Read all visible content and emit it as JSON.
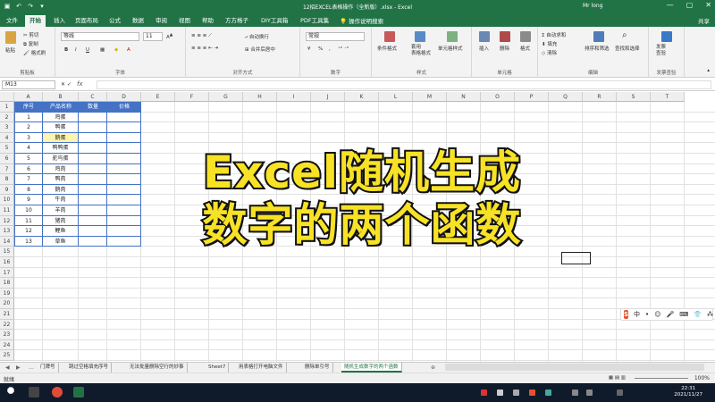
{
  "titlebar": {
    "title": "12招EXCEL表格操作（全新版）.xlsx - Excel",
    "user": "Mr long",
    "minimize": "—",
    "maximize": "▢",
    "close": "✕"
  },
  "tabs": [
    "文件",
    "开始",
    "插入",
    "页面布局",
    "公式",
    "数据",
    "审阅",
    "视图",
    "帮助",
    "方方格子",
    "DIY工具箱",
    "PDF工具集"
  ],
  "active_tab": "开始",
  "tell_me": "操作说明搜索",
  "share": "共享",
  "ribbon": {
    "clipboard": {
      "paste": "粘贴",
      "cut": "剪切",
      "copy": "复制",
      "format_painter": "格式刷",
      "label": "剪贴板"
    },
    "font": {
      "name": "等线",
      "size": "11",
      "bold": "B",
      "italic": "I",
      "underline": "U",
      "label": "字体"
    },
    "align": {
      "wrap": "自动换行",
      "merge": "合并后居中",
      "label": "对齐方式"
    },
    "number": {
      "format": "常规",
      "percent": "%",
      "comma": ",",
      "label": "数字"
    },
    "styles": {
      "cond": "条件格式",
      "table": "套用\n表格格式",
      "cell": "单元格样式",
      "label": "样式"
    },
    "cells": {
      "insert": "插入",
      "delete": "删除",
      "format": "格式",
      "label": "单元格"
    },
    "editing": {
      "autosum": "自动求和",
      "fill": "填充",
      "clear": "清除",
      "sort": "排序和筛选",
      "find": "查找和选择",
      "label": "编辑"
    },
    "send": {
      "label": "发票\n查验",
      "group": "发票查验"
    }
  },
  "formula_bar": {
    "name_box": "M13",
    "fx": "fx",
    "value": ""
  },
  "columns": [
    "A",
    "B",
    "C",
    "D",
    "E",
    "F",
    "G",
    "H",
    "I",
    "J",
    "K",
    "L",
    "M",
    "N",
    "O",
    "P",
    "Q",
    "R",
    "S",
    "T"
  ],
  "rows": [
    "1",
    "2",
    "3",
    "4",
    "5",
    "6",
    "7",
    "8",
    "9",
    "10",
    "11",
    "12",
    "13",
    "14",
    "15",
    "16",
    "17",
    "18",
    "19",
    "20",
    "21",
    "22",
    "23",
    "24",
    "25"
  ],
  "table": {
    "headers": [
      "序号",
      "产品名称",
      "数量",
      "价格"
    ],
    "rows": [
      [
        "1",
        "鸡蛋"
      ],
      [
        "2",
        "鸭蛋"
      ],
      [
        "3",
        "鹅蛋"
      ],
      [
        "4",
        "鸭鸭蛋"
      ],
      [
        "5",
        "驼鸟蛋"
      ],
      [
        "6",
        "鸡肉"
      ],
      [
        "7",
        "鸭肉"
      ],
      [
        "8",
        "鹅肉"
      ],
      [
        "9",
        "牛肉"
      ],
      [
        "10",
        "羊肉"
      ],
      [
        "11",
        "猪肉"
      ],
      [
        "12",
        "鲤鱼"
      ],
      [
        "13",
        "草鱼"
      ]
    ]
  },
  "overlay": {
    "line1": "Excel随机生成",
    "line2": "数字的两个函数"
  },
  "ime": {
    "logo": "S",
    "items": [
      "中",
      "•",
      "☺",
      "🎤",
      "⌨",
      "👕",
      "⁂"
    ]
  },
  "sheets": [
    "门牌号",
    "跳过空格填充序号",
    "无法批量删除空行的妙事",
    "Sheet7",
    "用表格打开电脑文件",
    "删除单引号",
    "随机生成数字的两个函数"
  ],
  "active_sheet": "随机生成数字的两个函数",
  "status": {
    "ready": "就绪",
    "zoom": "100%"
  },
  "taskbar": {
    "time": "22:31",
    "date": "2021/11/27"
  },
  "colors": {
    "excel_green": "#217346",
    "table_blue": "#4472c4",
    "overlay_yellow": "#f7e225",
    "taskbar": "#0f1a2a"
  }
}
